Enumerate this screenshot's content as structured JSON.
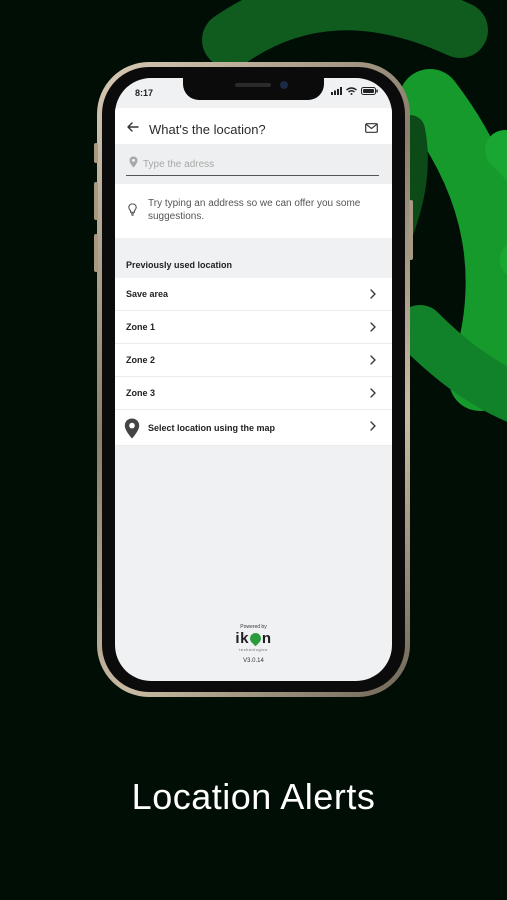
{
  "status_bar": {
    "time": "8:17"
  },
  "header": {
    "title": "What's the location?"
  },
  "search": {
    "placeholder": "Type the adress",
    "value": ""
  },
  "hint": {
    "text": "Try typing an address so we can offer you some suggestions."
  },
  "previous": {
    "title": "Previously used location",
    "items": [
      {
        "label": "Save area"
      },
      {
        "label": "Zone 1"
      },
      {
        "label": "Zone 2"
      },
      {
        "label": "Zone 3"
      }
    ]
  },
  "map_option": {
    "label": "Select location using the map"
  },
  "footer": {
    "powered_by": "Powered by",
    "logo_left": "ik",
    "logo_right": "n",
    "logo_sub": "technologies",
    "version": "V3.0.14"
  },
  "caption": {
    "text": "Location Alerts"
  },
  "colors": {
    "background": "#010e05",
    "accent_green": "#1fae3a",
    "screen_bg": "#f0f1f2"
  },
  "icons": [
    "back-arrow-icon",
    "mail-icon",
    "location-pin-icon",
    "lightbulb-icon",
    "chevron-right-icon",
    "wifi-icon",
    "signal-icon",
    "battery-icon"
  ]
}
